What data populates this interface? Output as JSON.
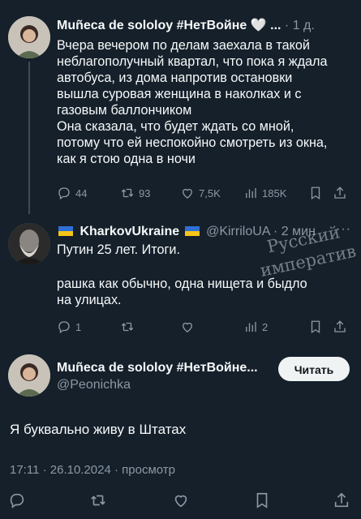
{
  "tweet1": {
    "name": "Muñeca de sololoy #НетВойне",
    "heart_emoji": "🤍",
    "ellipsis": "...",
    "time": "1 д.",
    "lines": [
      "Вчера вечером по делам заехала в такой",
      "неблагополучный квартал, что пока я ждала",
      "автобуса, из дома напротив остановки",
      "вышла суровая женщина в наколках и с",
      "газовым баллончиком",
      "Она сказала, что будет ждать со мной,",
      "потому что ей неспокойно смотреть из окна,",
      "как я стою одна в ночи"
    ],
    "replies": "44",
    "reposts": "93",
    "likes": "7,5K",
    "views": "185K"
  },
  "tweet2": {
    "name": "KharkovUkraine",
    "handle": "@KirriloUA",
    "time": "2 мин",
    "more": "···",
    "lines": [
      "Путин 25 лет. Итоги.",
      "",
      "рашка как обычно, одна нищета и  быдло",
      "на улицах."
    ],
    "replies": "1",
    "views": "2"
  },
  "watermark": {
    "line1": "Русский",
    "line2": "императив"
  },
  "tweet3": {
    "name": "Muñeca de sololoy #НетВойне...",
    "handle": "@Peonichka",
    "follow_label": "Читать",
    "text": "Я буквально живу в Штатах",
    "meta": "17:11 · 26.10.2024 · просмотр"
  },
  "colors": {
    "background": "#15202b",
    "text": "#f7f9f9",
    "muted": "#8b98a5",
    "button": "#eff3f4"
  }
}
